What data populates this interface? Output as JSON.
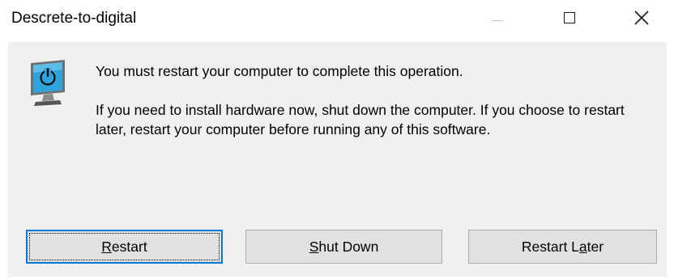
{
  "window": {
    "title": "Descrete-to-digital",
    "controls": {
      "minimize_icon": "minimize-icon",
      "maximize_icon": "maximize-icon",
      "close_icon": "close-icon"
    }
  },
  "dialog": {
    "icon": "restart-power-monitor-icon",
    "message_primary": "You must restart your computer to complete this operation.",
    "message_secondary": "If you need to install hardware now, shut down the computer. If you choose to restart later, restart your computer before running any of this software."
  },
  "buttons": {
    "restart": {
      "accesskey": "R",
      "rest": "estart"
    },
    "shutdown": {
      "accesskey": "S",
      "rest": "hut Down"
    },
    "restart_later": {
      "prefix": "Restart L",
      "accesskey": "a",
      "rest": "ter"
    }
  },
  "colors": {
    "content_bg": "#f0f0f0",
    "button_bg": "#e1e1e1",
    "button_border": "#adadad",
    "focus_border": "#0078d7",
    "monitor_screen": "#2fa3dc"
  }
}
